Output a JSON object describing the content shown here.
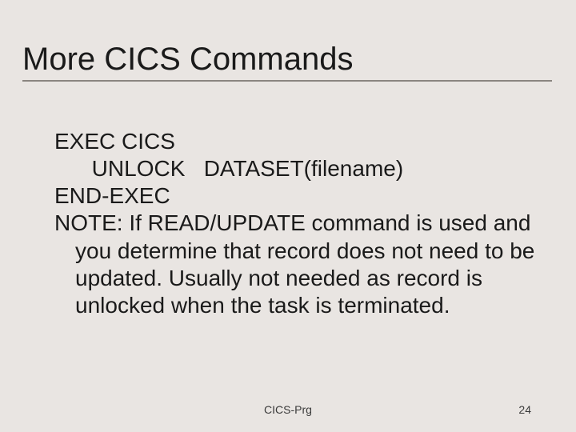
{
  "slide": {
    "title": "More CICS Commands",
    "body": {
      "line1": "EXEC CICS",
      "line2": "      UNLOCK   DATASET(filename)",
      "line3": "END-EXEC",
      "note": "NOTE: If READ/UPDATE command is used and you determine that record does not need to be updated. Usually not needed as record is unlocked when the task is terminated."
    },
    "footer_center": "CICS-Prg",
    "footer_page": "24"
  }
}
